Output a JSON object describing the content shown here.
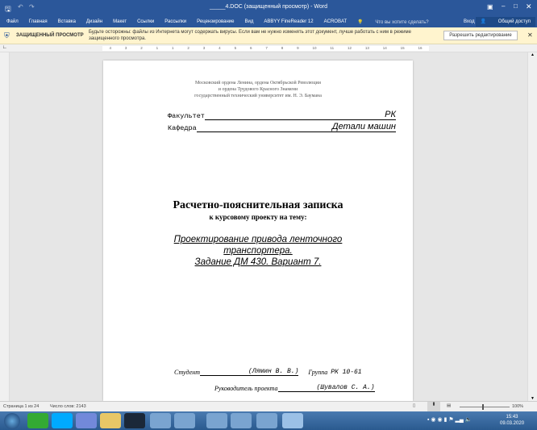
{
  "window": {
    "title": "_____4.DOC (защищенный просмотр) - Word"
  },
  "ribbon": {
    "tabs": [
      "Файл",
      "Главная",
      "Вставка",
      "Дизайн",
      "Макет",
      "Ссылки",
      "Рассылки",
      "Рецензирование",
      "Вид",
      "ABBYY FineReader 12",
      "ACROBAT"
    ],
    "search_placeholder": "Что вы хотите сделать?",
    "signin": "Вход",
    "share": "Общий доступ"
  },
  "message_bar": {
    "title": "ЗАЩИЩЕННЫЙ ПРОСМОТР",
    "text": "Будьте осторожны: файлы из Интернета могут содержать вирусы. Если вам не нужно изменять этот документ, лучше работать с ним в режиме защищенного просмотра.",
    "button": "Разрешить редактирование"
  },
  "ruler": {
    "ticks": [
      "4",
      "3",
      "2",
      "1",
      "1",
      "2",
      "3",
      "4",
      "5",
      "6",
      "7",
      "8",
      "9",
      "10",
      "11",
      "12",
      "13",
      "14",
      "15",
      "16"
    ]
  },
  "document": {
    "header": [
      "Московский ордена Ленина, ордена Октябрьской Революции",
      "и ордена Трудового Красного Знамени",
      "государственный технический университет им. Н. Э. Баумана"
    ],
    "faculty_label": "Факультет",
    "faculty_value": "РК",
    "dept_label": "Кафедра",
    "dept_value": "Детали машин",
    "title": "Расчетно-пояснительная записка",
    "subtitle": "к курсовому проекту на тему:",
    "topic": [
      "Проектирование привода ленточного",
      "транспортера.",
      "Задание ДМ 430. Вариант 7."
    ],
    "student_label": "Студент",
    "student_name": "(Лямин В. В.)",
    "group_label": "Группа",
    "group_value": "РК 10-61",
    "supervisor_label": "Руководитель проекта",
    "supervisor_name": "(Шувалов С. А.)"
  },
  "status": {
    "page": "Страница 1 из 24",
    "words": "Число слов: 2143",
    "zoom": "100%"
  },
  "taskbar": {
    "time": "15:43",
    "date": "09.03.2020",
    "apps": [
      "utorrent",
      "skype",
      "discord",
      "explorer",
      "steam",
      "chrome",
      "heart-app",
      "app-x",
      "snipping-tool",
      "winrar",
      "word"
    ]
  },
  "colors": {
    "word_blue": "#2b579a",
    "message_bar": "#fff4ce"
  }
}
